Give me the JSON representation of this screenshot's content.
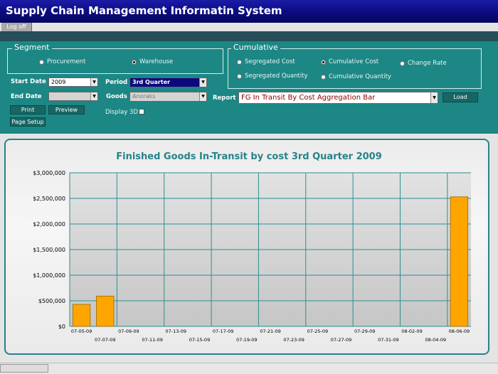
{
  "app": {
    "title": "Supply Chain Management Informatin System",
    "logoff_label": "Log off"
  },
  "segment": {
    "legend": "Segment",
    "options": [
      {
        "label": "Procurement",
        "selected": false
      },
      {
        "label": "Warehouse",
        "selected": true
      }
    ]
  },
  "cumulative": {
    "legend": "Cumulative",
    "options": [
      {
        "label": "Segregated Cost",
        "selected": false
      },
      {
        "label": "Cumulative Cost",
        "selected": true
      },
      {
        "label": "Change Rate",
        "selected": false
      },
      {
        "label": "Segregated Quantity",
        "selected": false
      },
      {
        "label": "Cumulative Quantity",
        "selected": false
      }
    ]
  },
  "form": {
    "start_date_label": "Start Date",
    "start_date_value": "2009",
    "end_date_label": "End Date",
    "end_date_value": "",
    "period_label": "Period",
    "period_value": "3rd Quarter",
    "goods_label": "Goods",
    "goods_value": "Anoraks",
    "report_label": "Report",
    "report_value": "FG In Transit By Cost Aggregation Bar",
    "display3d_label": "Display 3D",
    "display3d_checked": false
  },
  "buttons": {
    "print": "Print",
    "preview": "Preview",
    "page_setup": "Page Setup",
    "load": "Load"
  },
  "colors": {
    "bar": "#ffa500",
    "bar_stroke": "#9a6a00",
    "grid": "#2b8f93",
    "title": "#27828a"
  },
  "chart_data": {
    "type": "bar",
    "title": "Finished Goods In-Transit by cost 3rd Quarter 2009",
    "ylim": [
      0,
      3000000
    ],
    "yticks": [
      0,
      500000,
      1000000,
      1500000,
      2000000,
      2500000,
      3000000
    ],
    "ytick_labels": [
      "$0",
      "$500,000",
      "$1,000,000",
      "$1,500,000",
      "$2,000,000",
      "$2,500,000",
      "$3,000,000"
    ],
    "categories": [
      "07-05-09",
      "07-07-09",
      "07-09-09",
      "07-11-09",
      "07-13-09",
      "07-15-09",
      "07-17-09",
      "07-19-09",
      "07-21-09",
      "07-23-09",
      "07-25-09",
      "07-27-09",
      "07-29-09",
      "07-31-09",
      "08-02-09",
      "08-04-09",
      "08-06-09"
    ],
    "values": [
      430000,
      590000,
      0,
      0,
      0,
      0,
      0,
      0,
      0,
      0,
      0,
      0,
      0,
      0,
      0,
      0,
      2530000
    ]
  }
}
